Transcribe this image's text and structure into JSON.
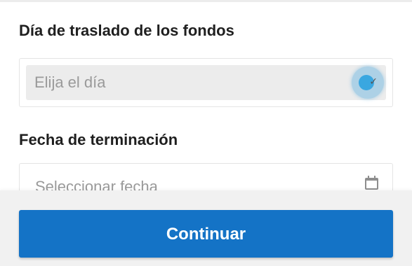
{
  "form": {
    "transfer_day": {
      "label": "Día de traslado de los fondos",
      "placeholder": "Elija el día",
      "icon": "chevron-down-icon"
    },
    "end_date": {
      "label": "Fecha de terminación",
      "placeholder": "Seleccionar fecha",
      "icon": "calendar-icon"
    }
  },
  "footer": {
    "continue_label": "Continuar",
    "button_color": "#1473c6"
  },
  "colors": {
    "select_background": "#ececec",
    "ripple": "#3aa7e0",
    "footer_background": "#f1f1f1"
  }
}
